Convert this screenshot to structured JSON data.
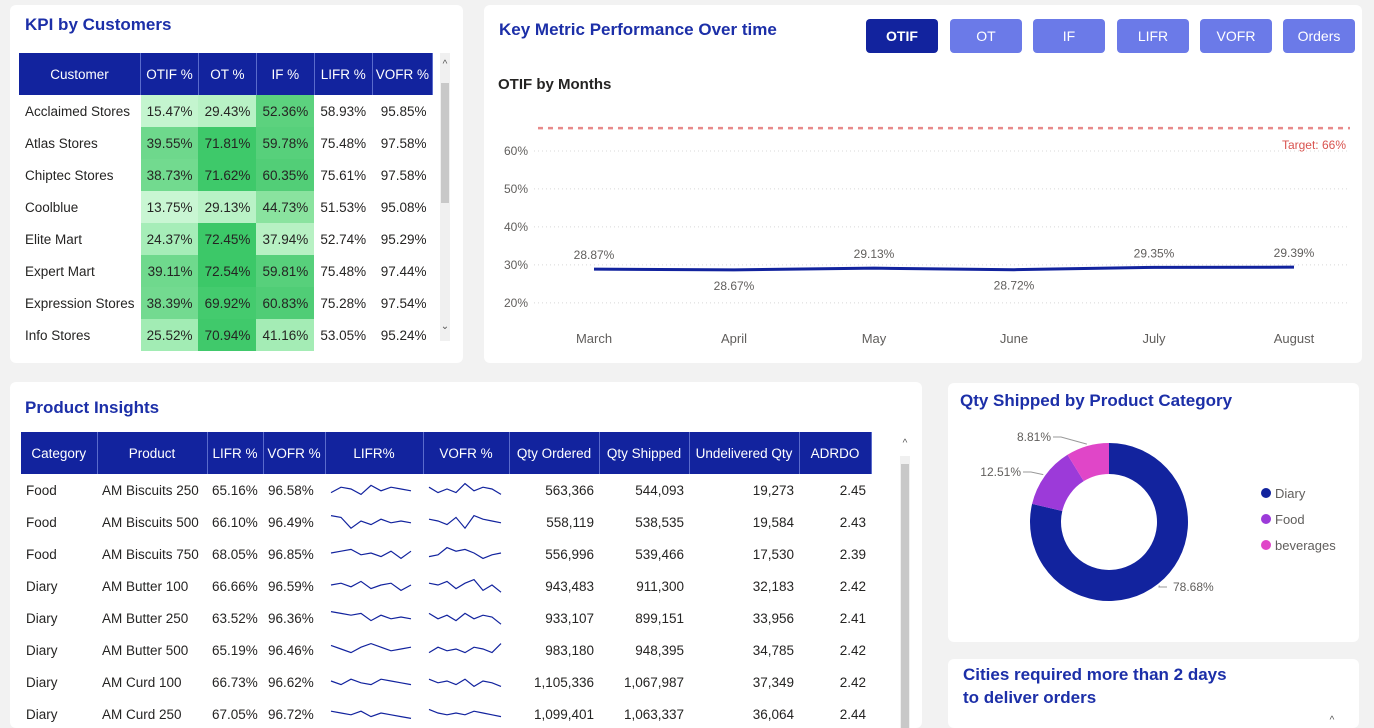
{
  "kpi": {
    "title": "KPI by Customers",
    "headers": [
      "Customer",
      "OTIF %",
      "OT %",
      "IF %",
      "LIFR %",
      "VOFR %"
    ],
    "rows": [
      {
        "customer": "Acclaimed Stores",
        "otif": "15.47%",
        "ot": "29.43%",
        "if": "52.36%",
        "lifr": "58.93%",
        "vofr": "95.85%"
      },
      {
        "customer": "Atlas Stores",
        "otif": "39.55%",
        "ot": "71.81%",
        "if": "59.78%",
        "lifr": "75.48%",
        "vofr": "97.58%"
      },
      {
        "customer": "Chiptec Stores",
        "otif": "38.73%",
        "ot": "71.62%",
        "if": "60.35%",
        "lifr": "75.61%",
        "vofr": "97.58%"
      },
      {
        "customer": "Coolblue",
        "otif": "13.75%",
        "ot": "29.13%",
        "if": "44.73%",
        "lifr": "51.53%",
        "vofr": "95.08%"
      },
      {
        "customer": "Elite Mart",
        "otif": "24.37%",
        "ot": "72.45%",
        "if": "37.94%",
        "lifr": "52.74%",
        "vofr": "95.29%"
      },
      {
        "customer": "Expert Mart",
        "otif": "39.11%",
        "ot": "72.54%",
        "if": "59.81%",
        "lifr": "75.48%",
        "vofr": "97.44%"
      },
      {
        "customer": "Expression Stores",
        "otif": "38.39%",
        "ot": "69.92%",
        "if": "60.83%",
        "lifr": "75.28%",
        "vofr": "97.54%"
      },
      {
        "customer": "Info Stores",
        "otif": "25.52%",
        "ot": "70.94%",
        "if": "41.16%",
        "lifr": "53.05%",
        "vofr": "95.24%"
      }
    ],
    "heat_colors": {
      "otif": [
        "#c4f5cf",
        "#6ed88c",
        "#72da8f",
        "#c9f6d3",
        "#a6edb8",
        "#6fd98d",
        "#73da90",
        "#a2ecb4"
      ],
      "ot": [
        "#b8f2c5",
        "#3ec96a",
        "#3ec96a",
        "#b9f2c6",
        "#3cc868",
        "#3cc868",
        "#44cb6e",
        "#40c96b"
      ],
      "if": [
        "#5cd27e",
        "#57d07b",
        "#52ce77",
        "#8ae39f",
        "#b7f1c3",
        "#57d07b",
        "#50cd76",
        "#a4ecb5"
      ]
    }
  },
  "metric": {
    "title": "Key Metric Performance Over time",
    "buttons": [
      "OTIF",
      "OT",
      "IF",
      "LIFR",
      "VOFR",
      "Orders"
    ],
    "active_button": "OTIF"
  },
  "chart_data": {
    "type": "line",
    "title": "OTIF by Months",
    "x": [
      "March",
      "April",
      "May",
      "June",
      "July",
      "August"
    ],
    "series": [
      {
        "values": [
          28.87,
          28.67,
          29.13,
          28.72,
          29.35,
          29.39
        ]
      }
    ],
    "data_labels": [
      "28.87%",
      "28.67%",
      "29.13%",
      "28.72%",
      "29.35%",
      "29.39%"
    ],
    "y_ticks": [
      "20%",
      "30%",
      "40%",
      "50%",
      "60%"
    ],
    "ylim": [
      16,
      70
    ],
    "target": {
      "value": 66,
      "label": "Target: 66%"
    },
    "line_color": "#12239e",
    "target_color": "#e88a8a",
    "grid": true
  },
  "product": {
    "title": "Product Insights",
    "headers": [
      "Category",
      "Product",
      "LIFR %",
      "VOFR %",
      "LIFR%",
      "VOFR %",
      "Qty Ordered",
      "Qty Shipped",
      "Undelivered Qty",
      "ADRDO"
    ],
    "rows": [
      {
        "category": "Food",
        "product": "AM Biscuits 250",
        "lifr": "65.16%",
        "vofr": "96.58%",
        "ordered": "563,366",
        "shipped": "544,093",
        "undelivered": "19,273",
        "adrdo": "2.45",
        "spark_lifr": [
          0.3,
          0.6,
          0.5,
          0.2,
          0.7,
          0.4,
          0.6,
          0.5,
          0.4
        ],
        "spark_vofr": [
          0.6,
          0.3,
          0.5,
          0.3,
          0.8,
          0.4,
          0.6,
          0.5,
          0.2
        ]
      },
      {
        "category": "Food",
        "product": "AM Biscuits 500",
        "lifr": "66.10%",
        "vofr": "96.49%",
        "ordered": "558,119",
        "shipped": "538,535",
        "undelivered": "19,584",
        "adrdo": "2.43",
        "spark_lifr": [
          0.8,
          0.7,
          0.1,
          0.5,
          0.3,
          0.6,
          0.4,
          0.5,
          0.4
        ],
        "spark_vofr": [
          0.6,
          0.5,
          0.3,
          0.7,
          0.1,
          0.8,
          0.6,
          0.5,
          0.4
        ]
      },
      {
        "category": "Food",
        "product": "AM Biscuits 750",
        "lifr": "68.05%",
        "vofr": "96.85%",
        "ordered": "556,996",
        "shipped": "539,466",
        "undelivered": "17,530",
        "adrdo": "2.39",
        "spark_lifr": [
          0.5,
          0.6,
          0.7,
          0.4,
          0.5,
          0.3,
          0.6,
          0.2,
          0.6
        ],
        "spark_vofr": [
          0.3,
          0.4,
          0.8,
          0.6,
          0.7,
          0.5,
          0.2,
          0.4,
          0.5
        ]
      },
      {
        "category": "Diary",
        "product": "AM Butter 100",
        "lifr": "66.66%",
        "vofr": "96.59%",
        "ordered": "943,483",
        "shipped": "911,300",
        "undelivered": "32,183",
        "adrdo": "2.42",
        "spark_lifr": [
          0.5,
          0.6,
          0.4,
          0.7,
          0.3,
          0.5,
          0.6,
          0.2,
          0.5
        ],
        "spark_vofr": [
          0.6,
          0.5,
          0.7,
          0.3,
          0.6,
          0.8,
          0.2,
          0.5,
          0.1
        ]
      },
      {
        "category": "Diary",
        "product": "AM Butter 250",
        "lifr": "63.52%",
        "vofr": "96.36%",
        "ordered": "933,107",
        "shipped": "899,151",
        "undelivered": "33,956",
        "adrdo": "2.41",
        "spark_lifr": [
          0.8,
          0.7,
          0.6,
          0.7,
          0.3,
          0.6,
          0.4,
          0.5,
          0.4
        ],
        "spark_vofr": [
          0.7,
          0.4,
          0.6,
          0.3,
          0.7,
          0.4,
          0.6,
          0.5,
          0.1
        ]
      },
      {
        "category": "Diary",
        "product": "AM Butter 500",
        "lifr": "65.19%",
        "vofr": "96.46%",
        "ordered": "983,180",
        "shipped": "948,395",
        "undelivered": "34,785",
        "adrdo": "2.42",
        "spark_lifr": [
          0.7,
          0.5,
          0.3,
          0.6,
          0.8,
          0.6,
          0.4,
          0.5,
          0.6
        ],
        "spark_vofr": [
          0.3,
          0.6,
          0.4,
          0.5,
          0.3,
          0.6,
          0.5,
          0.3,
          0.8
        ]
      },
      {
        "category": "Diary",
        "product": "AM Curd 100",
        "lifr": "66.73%",
        "vofr": "96.62%",
        "ordered": "1,105,336",
        "shipped": "1,067,987",
        "undelivered": "37,349",
        "adrdo": "2.42",
        "spark_lifr": [
          0.5,
          0.3,
          0.6,
          0.4,
          0.3,
          0.6,
          0.5,
          0.4,
          0.3
        ],
        "spark_vofr": [
          0.6,
          0.4,
          0.5,
          0.3,
          0.6,
          0.2,
          0.5,
          0.4,
          0.2
        ]
      },
      {
        "category": "Diary",
        "product": "AM Curd 250",
        "lifr": "67.05%",
        "vofr": "96.72%",
        "ordered": "1,099,401",
        "shipped": "1,063,337",
        "undelivered": "36,064",
        "adrdo": "2.44",
        "spark_lifr": [
          0.6,
          0.5,
          0.4,
          0.6,
          0.3,
          0.5,
          0.4,
          0.3,
          0.2
        ],
        "spark_vofr": [
          0.7,
          0.5,
          0.4,
          0.5,
          0.4,
          0.6,
          0.5,
          0.4,
          0.3
        ]
      }
    ]
  },
  "donut": {
    "title": "Qty Shipped by Product Category",
    "slices": [
      {
        "name": "Diary",
        "value": 78.68,
        "label": "78.68%",
        "color": "#12239e"
      },
      {
        "name": "Food",
        "value": 12.51,
        "label": "12.51%",
        "color": "#9c3ad9"
      },
      {
        "name": "beverages",
        "value": 8.81,
        "label": "8.81%",
        "color": "#e046c8"
      }
    ]
  },
  "cities": {
    "title_line1": "Cities required more than 2 days",
    "title_line2": "to deliver orders"
  }
}
